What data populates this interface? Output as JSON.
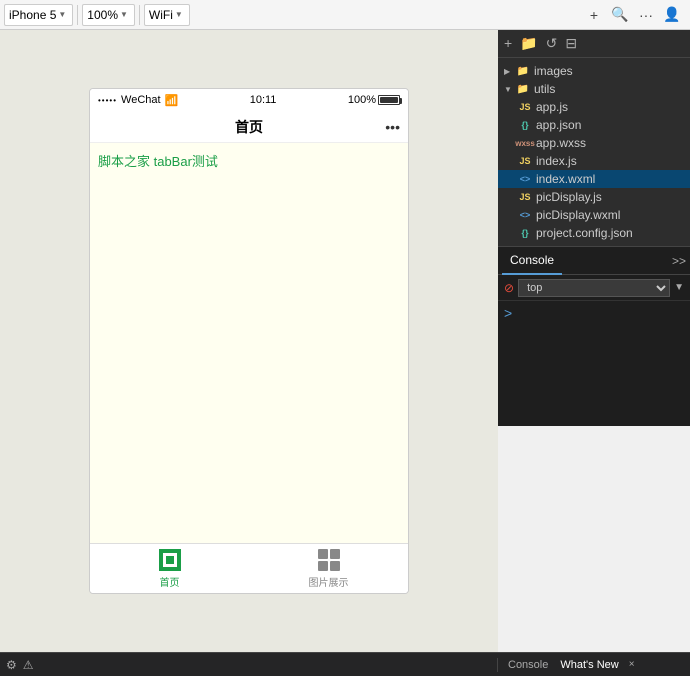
{
  "toolbar": {
    "device": "iPhone 5",
    "zoom": "100%",
    "network": "WiFi",
    "add_icon": "+",
    "search_icon": "🔍",
    "more_icon": "···",
    "profile_icon": "👤"
  },
  "phone": {
    "signal": "•••••",
    "app_name": "WeChat",
    "wifi": "📶",
    "time": "10:11",
    "battery_pct": "100%",
    "page_title": "首页",
    "nav_dots": "•••",
    "body_text": "脚本之家 tabBar测试",
    "tabs": [
      {
        "label": "首页",
        "active": true
      },
      {
        "label": "图片展示",
        "active": false
      }
    ]
  },
  "file_tree": {
    "items": [
      {
        "type": "folder",
        "name": "images",
        "indent": 0,
        "collapsed": true
      },
      {
        "type": "folder",
        "name": "utils",
        "indent": 0,
        "collapsed": false
      },
      {
        "type": "js",
        "name": "app.js",
        "indent": 1
      },
      {
        "type": "json",
        "name": "app.json",
        "indent": 1
      },
      {
        "type": "wxss",
        "name": "app.wxss",
        "indent": 1
      },
      {
        "type": "js",
        "name": "index.js",
        "indent": 1
      },
      {
        "type": "wxml",
        "name": "index.wxml",
        "indent": 1,
        "active": true
      },
      {
        "type": "js",
        "name": "picDisplay.js",
        "indent": 1
      },
      {
        "type": "wxml",
        "name": "picDisplay.wxml",
        "indent": 1
      },
      {
        "type": "json",
        "name": "project.config.json",
        "indent": 1
      }
    ]
  },
  "console": {
    "tab_label": "Console",
    "expand_icon": ">>",
    "filter_label": "top",
    "prompt": ">"
  },
  "bottom": {
    "left_icon1": "⚙",
    "left_icon2": "⚠",
    "console_tab": "Console",
    "whats_new_tab": "What's New",
    "close_icon": "×"
  }
}
